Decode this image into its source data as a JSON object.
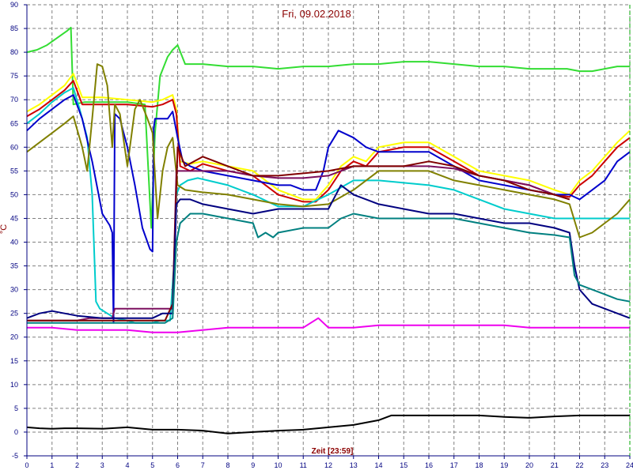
{
  "chart_data": {
    "type": "line",
    "title": "Fri, 09.02.2018",
    "xlabel": "Zeit [23:59]",
    "ylabel": "°C",
    "xlim": [
      0,
      24
    ],
    "ylim": [
      -5,
      90
    ],
    "x_ticks": [
      "0",
      "1",
      "2",
      "3",
      "4",
      "5",
      "6",
      "7",
      "8",
      "9",
      "10",
      "11",
      "12",
      "13",
      "14",
      "15",
      "16",
      "17",
      "18",
      "19",
      "20",
      "21",
      "22",
      "23",
      "24"
    ],
    "y_ticks": [
      "-5",
      "0",
      "5",
      "10",
      "15",
      "20",
      "25",
      "30",
      "35",
      "40",
      "45",
      "50",
      "55",
      "60",
      "65",
      "70",
      "75",
      "80",
      "85",
      "90"
    ],
    "grid": true,
    "legend": "none",
    "series": [
      {
        "color": "#33dd33",
        "x": [
          0,
          0.4,
          0.8,
          1.2,
          1.6,
          1.75,
          1.85,
          2.3,
          3,
          4,
          4.7,
          4.95,
          5.1,
          5.3,
          5.6,
          5.8,
          6.0,
          6.3,
          7,
          8,
          9,
          10,
          11,
          12,
          13,
          14,
          15,
          16,
          17,
          18,
          19,
          20,
          21,
          21.5,
          22,
          22.5,
          23,
          23.5,
          24
        ],
        "values": [
          80,
          80.5,
          81.5,
          83,
          84.5,
          85.2,
          69,
          69.5,
          69.5,
          69.5,
          69,
          43,
          63,
          75,
          79,
          80.5,
          81.5,
          77.5,
          77.5,
          77,
          77,
          76.5,
          77,
          77,
          77.5,
          77.5,
          78,
          78,
          77.5,
          77,
          77,
          76.5,
          76.5,
          76.5,
          76,
          76,
          76.5,
          77,
          77
        ]
      },
      {
        "color": "#ffff00",
        "x": [
          0,
          0.5,
          1,
          1.5,
          1.85,
          2.2,
          3,
          4,
          5,
          5.4,
          5.8,
          5.95,
          6.1,
          6.5,
          7,
          8,
          9,
          10,
          11,
          11.5,
          12,
          12.5,
          13,
          13.5,
          14,
          15,
          16,
          17,
          18,
          19,
          20,
          21,
          21.6,
          22,
          22.5,
          23,
          23.5,
          24
        ],
        "values": [
          67.5,
          69,
          71,
          73,
          75.5,
          70.5,
          70.5,
          70,
          69.5,
          70,
          71,
          68,
          57,
          56.5,
          57,
          56,
          55,
          51,
          49,
          49,
          52,
          56,
          58,
          57,
          60,
          61,
          61,
          58,
          55,
          54,
          53,
          51,
          50,
          53,
          55,
          58,
          61,
          63.5
        ]
      },
      {
        "color": "#cc0000",
        "x": [
          0,
          0.5,
          1,
          1.5,
          1.85,
          2.2,
          3,
          4,
          5,
          5.4,
          5.8,
          5.95,
          6.1,
          6.5,
          7,
          8,
          9,
          10,
          11,
          11.5,
          12,
          12.5,
          13,
          13.5,
          14,
          15,
          16,
          17,
          18,
          19,
          20,
          21,
          21.6,
          22,
          22.5,
          23,
          23.5,
          24
        ],
        "values": [
          66.5,
          68,
          70,
          72,
          74,
          69,
          69,
          69,
          68.5,
          69,
          70,
          67,
          56,
          55,
          56.5,
          55,
          54,
          50,
          48.5,
          48.5,
          51,
          55,
          57,
          56,
          59,
          60,
          60,
          57,
          54,
          53,
          52,
          50,
          49.5,
          52,
          54,
          57,
          60,
          62
        ]
      },
      {
        "color": "#00cccc",
        "x": [
          0,
          0.5,
          1,
          1.5,
          1.85,
          2.1,
          2.4,
          2.6,
          2.75,
          2.9,
          3.5,
          4,
          4.3,
          4.5,
          5,
          5.3,
          5.7,
          5.85,
          5.95,
          6.1,
          6.4,
          6.8,
          7.2,
          8,
          9,
          10,
          11,
          12,
          13,
          14,
          15,
          16,
          17,
          18,
          19,
          20,
          21,
          21.6,
          22,
          22.5,
          23,
          23.5,
          24
        ],
        "values": [
          65,
          67,
          69.5,
          71.5,
          72.5,
          68,
          62,
          50,
          27.5,
          26,
          24,
          23.5,
          23,
          23,
          23,
          23.5,
          23.5,
          35,
          50,
          52,
          53,
          53.5,
          53,
          52,
          50,
          47.5,
          47.5,
          50,
          53,
          53,
          52.5,
          52,
          51,
          49,
          47,
          46,
          45,
          45,
          45,
          45,
          45,
          45,
          45
        ]
      },
      {
        "color": "#0000cc",
        "x": [
          0,
          0.5,
          1,
          1.5,
          1.85,
          2.2,
          2.6,
          3.0,
          3.3,
          3.4,
          3.45,
          3.5,
          3.7,
          4.0,
          4.3,
          4.6,
          4.9,
          5.0,
          5.05,
          5.1,
          5.3,
          5.6,
          5.8,
          6.0,
          6.2,
          6.5,
          7,
          8,
          9,
          10,
          10.5,
          11,
          11.5,
          11.8,
          12,
          12.4,
          12.6,
          13,
          13.5,
          14,
          15,
          16,
          17,
          18,
          19,
          20,
          21,
          21.6,
          22,
          22.5,
          23,
          23.5,
          24
        ],
        "values": [
          63.5,
          66,
          68,
          70,
          71,
          66,
          57,
          46,
          43.5,
          42,
          23,
          67,
          66,
          60,
          52,
          43,
          38.5,
          38,
          64,
          66,
          66,
          66,
          67.5,
          62,
          57,
          56,
          55,
          54,
          53,
          52,
          52,
          51,
          51,
          55,
          60,
          63.5,
          63,
          62,
          60,
          59,
          59,
          59,
          56,
          53,
          52,
          51,
          50,
          50,
          49,
          51,
          53,
          57,
          59
        ]
      },
      {
        "color": "#808000",
        "x": [
          0,
          0.5,
          1,
          1.5,
          1.85,
          2.2,
          2.4,
          2.6,
          2.8,
          3.0,
          3.2,
          3.4,
          3.5,
          3.7,
          4.0,
          4.3,
          4.5,
          4.8,
          5.0,
          5.2,
          5.4,
          5.6,
          5.8,
          6.0,
          6.3,
          7,
          8,
          9,
          10,
          11,
          12,
          13,
          14,
          15,
          16,
          17,
          18,
          19,
          20,
          21,
          21.6,
          22,
          22.5,
          23,
          23.5,
          24
        ],
        "values": [
          59,
          61,
          63,
          65,
          66.5,
          60,
          55,
          66,
          77.5,
          77,
          73,
          60,
          69,
          67,
          56,
          68,
          70,
          66,
          63,
          45,
          55,
          60,
          62,
          52,
          51,
          50.5,
          50,
          49,
          48,
          47.5,
          48,
          51,
          55,
          55,
          55,
          53,
          52,
          51,
          50,
          49,
          48,
          41,
          42,
          44,
          46,
          49
        ]
      },
      {
        "color": "#7b0f5f",
        "x": [
          0,
          1,
          2,
          2.5,
          3,
          3.4,
          3.5,
          4,
          5,
          5.5,
          5.8,
          5.95,
          6.1,
          6.5,
          7,
          8,
          9,
          10,
          11,
          12,
          12.5,
          13,
          14,
          15,
          16,
          17,
          18,
          19,
          20,
          21,
          21.6
        ],
        "values": [
          23.5,
          23.5,
          23.5,
          24,
          24,
          24,
          26,
          26,
          26,
          26,
          26,
          55,
          55,
          55,
          55,
          55,
          54,
          53.5,
          53.5,
          54,
          55,
          56,
          56,
          56,
          56,
          55.5,
          54,
          53,
          52,
          50,
          49
        ]
      },
      {
        "color": "#800000",
        "x": [
          0,
          1,
          2,
          3,
          4,
          5,
          5.5,
          5.8,
          6.0,
          6.3,
          7,
          8,
          9,
          10,
          11,
          12,
          13,
          14,
          15,
          16,
          17,
          18,
          19,
          20,
          21,
          21.6
        ],
        "values": [
          23.5,
          23.5,
          23.5,
          23.5,
          23.5,
          23.5,
          23.5,
          27,
          60,
          56,
          58,
          56,
          54,
          54,
          54.5,
          55,
          56,
          56,
          56,
          57,
          56,
          54,
          53,
          51,
          50,
          49
        ]
      },
      {
        "color": "#000080",
        "x": [
          0,
          0.5,
          1,
          1.5,
          2,
          3,
          4,
          5,
          5.4,
          5.8,
          5.95,
          6.1,
          6.5,
          7,
          8,
          9,
          10,
          11,
          12,
          12.5,
          13,
          14,
          15,
          16,
          17,
          18,
          19,
          20,
          21,
          21.6,
          21.8,
          22,
          22.5,
          23,
          23.5,
          24
        ],
        "values": [
          24,
          25,
          25.5,
          25,
          24.5,
          24,
          24,
          24,
          25,
          25,
          48,
          49,
          49,
          48,
          47,
          46,
          47,
          47,
          47,
          52,
          50,
          48,
          47,
          46,
          46,
          45,
          44,
          44,
          43,
          42,
          35,
          30,
          27,
          26,
          25,
          24
        ]
      },
      {
        "color": "#008080",
        "x": [
          0,
          1,
          2,
          3,
          4,
          5,
          5.5,
          5.8,
          5.95,
          6.1,
          6.5,
          7,
          8,
          9,
          9.2,
          9.5,
          9.8,
          10,
          11,
          11.5,
          12,
          12.5,
          13,
          14,
          15,
          16,
          17,
          18,
          19,
          20,
          21,
          21.6,
          21.8,
          22,
          22.5,
          23,
          23.5,
          24
        ],
        "values": [
          23,
          23,
          23,
          23,
          23,
          23,
          23,
          24,
          40,
          44,
          46,
          46,
          45,
          44,
          41,
          42,
          41,
          42,
          43,
          43,
          43,
          45,
          46,
          45,
          45,
          45,
          45,
          44,
          43,
          42,
          41.5,
          41,
          33,
          31,
          30,
          29,
          28,
          27.5
        ]
      },
      {
        "color": "#ee00ee",
        "x": [
          0,
          1,
          2,
          3,
          4,
          5,
          5.5,
          6,
          7,
          8,
          9,
          10,
          11,
          11.3,
          11.6,
          12,
          13,
          14,
          15,
          16,
          17,
          18,
          19,
          20,
          21,
          22,
          23,
          24
        ],
        "values": [
          22,
          22,
          21.5,
          21.5,
          21.5,
          21,
          21,
          21,
          21.5,
          22,
          22,
          22,
          22,
          23,
          24,
          22,
          22,
          22.5,
          22.5,
          22.5,
          22.5,
          22.5,
          22.5,
          22,
          22,
          22,
          22,
          22
        ]
      },
      {
        "color": "#000000",
        "x": [
          0,
          0.5,
          1,
          1.5,
          2,
          3,
          4,
          5,
          6,
          7,
          8,
          9,
          10,
          11,
          12,
          13,
          13.5,
          14,
          14.5,
          15,
          16,
          17,
          18,
          19,
          20,
          21,
          22,
          23,
          24
        ],
        "values": [
          1,
          0.8,
          0.7,
          0.8,
          0.8,
          0.7,
          1,
          0.5,
          0.5,
          0.3,
          -0.3,
          0,
          0.3,
          0.5,
          1,
          1.5,
          2,
          2.5,
          3.5,
          3.5,
          3.5,
          3.5,
          3.5,
          3.2,
          3,
          3.3,
          3.5,
          3.5,
          3.5
        ]
      }
    ]
  }
}
